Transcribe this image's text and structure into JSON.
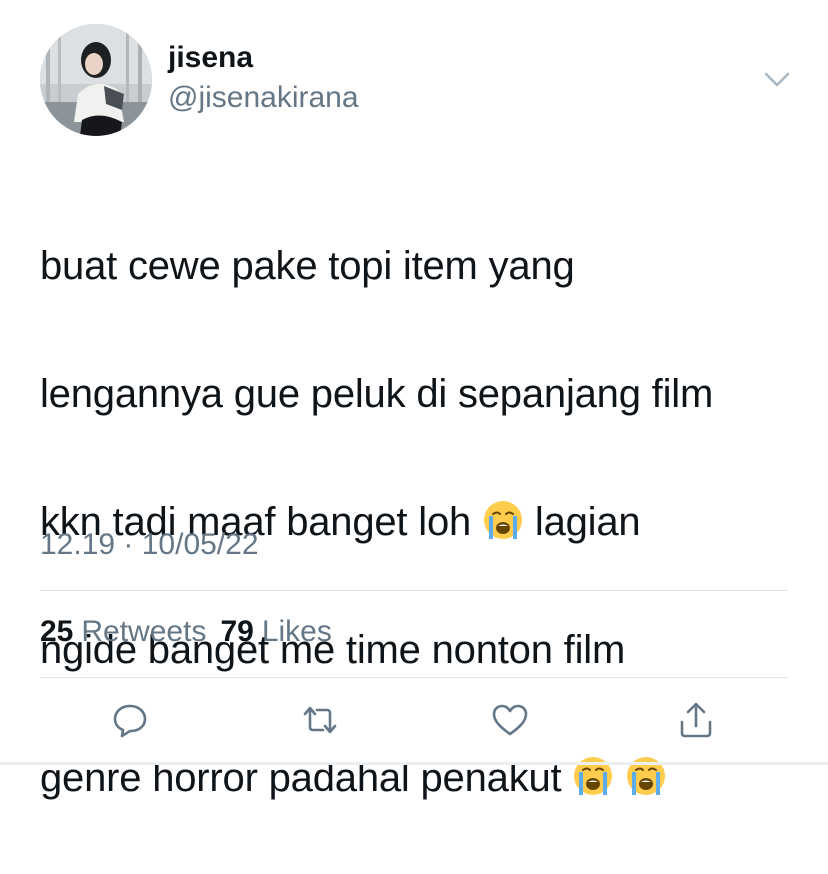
{
  "user": {
    "display_name": "jisena",
    "handle": "@jisenakirana"
  },
  "tweet": {
    "lines": [
      "buat cewe pake topi item yang",
      "lengannya gue peluk di sepanjang film",
      "kkn tadi maaf banget loh",
      "lagian",
      "ngide banget me time nonton film",
      "genre horror padahal penakut"
    ],
    "emoji_name": "loudly-crying-face-emoji",
    "timestamp": "12.19 · 10/05/22"
  },
  "stats": {
    "retweets_count": "25",
    "retweets_label": "Retweets",
    "likes_count": "79",
    "likes_label": "Likes"
  },
  "icons": {
    "menu": "chevron-down-icon",
    "reply": "reply-icon",
    "retweet": "retweet-icon",
    "like": "heart-icon",
    "share": "share-icon"
  },
  "colors": {
    "text_primary": "#0f1419",
    "text_secondary": "#657786",
    "divider": "#dfe3e6",
    "icon": "#657786"
  }
}
